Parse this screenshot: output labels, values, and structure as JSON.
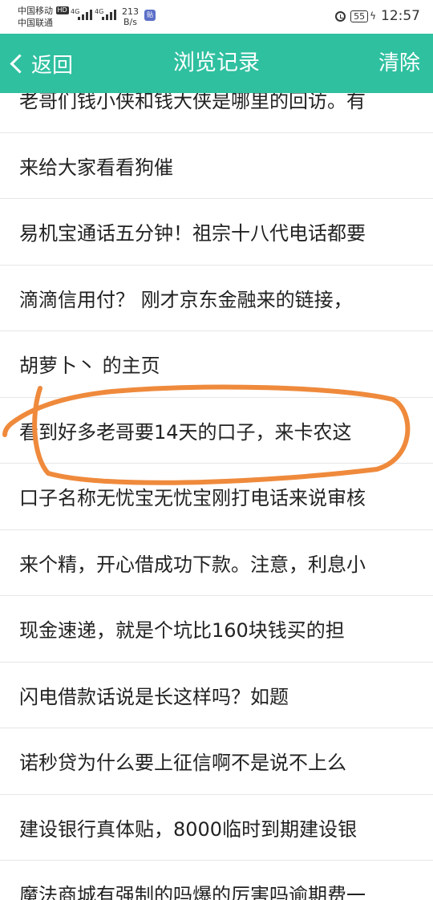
{
  "status_bar": {
    "carrier1": "中国移动",
    "carrier1_badge": "HD",
    "carrier2": "中国联通",
    "signal1_tag": "4G",
    "signal2_tag": "4G",
    "speed_value": "213",
    "speed_unit": "B/s",
    "battery": "55",
    "time": "12:57"
  },
  "nav": {
    "back_label": "返回",
    "title": "浏览记录",
    "clear_label": "清除"
  },
  "history": [
    "老哥们钱小侠和钱大侠是哪里的回访。有",
    "来给大家看看狗催",
    "易机宝通话五分钟！祖宗十八代电话都要",
    "滴滴信用付？ 刚才京东金融来的链接，",
    "胡萝卜丶 的主页",
    "看到好多老哥要14天的口子，来卡农这",
    "口子名称无忧宝无忧宝刚打电话来说审核",
    "来个精，开心借成功下款。注意，利息小",
    "现金速递，就是个坑比160块钱买的担",
    "闪电借款话说是长这样吗？如题",
    "诺秒贷为什么要上征信啊不是说不上么",
    "建设银行真体贴，8000临时到期建设银",
    "魔法商城有强制的吗爆的厉害吗逾期费一"
  ],
  "colors": {
    "nav_bg": "#2fc0a0",
    "annotation": "#ef8a3c"
  }
}
